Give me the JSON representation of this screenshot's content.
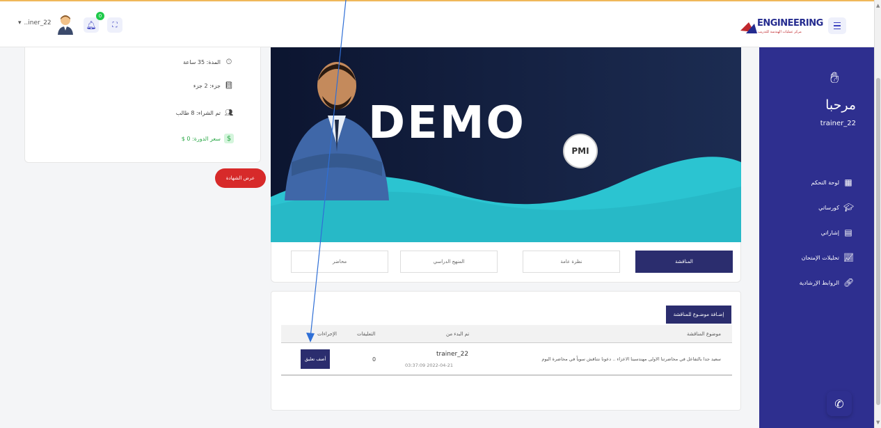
{
  "header": {
    "username": "..iner_22",
    "notification_count": "0",
    "logo_text": "ENGINEERING",
    "logo_subtext": "مركز عمليات الهندسة للتدريب"
  },
  "sidebar": {
    "greeting": "مرحبا",
    "username": "trainer_22",
    "items": [
      {
        "label": "لوحة التحكم",
        "icon": "dashboard-icon"
      },
      {
        "label": "كورساتي",
        "icon": "courses-icon"
      },
      {
        "label": "إشاراتي",
        "icon": "notes-icon"
      },
      {
        "label": "تحليلات الإمتحان",
        "icon": "chart-icon"
      },
      {
        "label": "الروابط الإرشادية",
        "icon": "link-icon"
      }
    ]
  },
  "course_info": {
    "duration": "المدة: 35 ساعة",
    "parts": "جزء: 2 جزء",
    "enrolled": "تم الشراء: 8 طالب",
    "price": "سعر الدورة: 0 $"
  },
  "certificate_button": "عرض الشهادة",
  "banner": {
    "title": "DEMO",
    "badge": "PMI"
  },
  "tabs": {
    "discussion": "المناقشة",
    "overview": "نظرة عامة",
    "curriculum": "المنهج الدراسي",
    "lecturer": "محاضر"
  },
  "discussion": {
    "add_topic_button": "إضـافة موضـوع للمناقشة",
    "columns": {
      "topic": "موضوع المناقشة",
      "started_by": "تم البدء من",
      "comments": "التعليقات",
      "actions": "الإجراءات"
    },
    "rows": [
      {
        "topic": "سعيد جدا بالتفاعل في محاضرتنا الاولى مهندسينا الاعزاء .. دعونا نتناقش سوياً في محاضرة اليوم",
        "author": "trainer_22",
        "date": "03:37:09 2022-04-21",
        "comments": "0",
        "action_label": "أضف تعليق"
      }
    ]
  },
  "colors": {
    "primary": "#2e2f8f",
    "dark_button": "#2b2d6e",
    "danger": "#d72a2a",
    "success": "#28a745",
    "annotation_arrow": "#2f6fd6"
  }
}
